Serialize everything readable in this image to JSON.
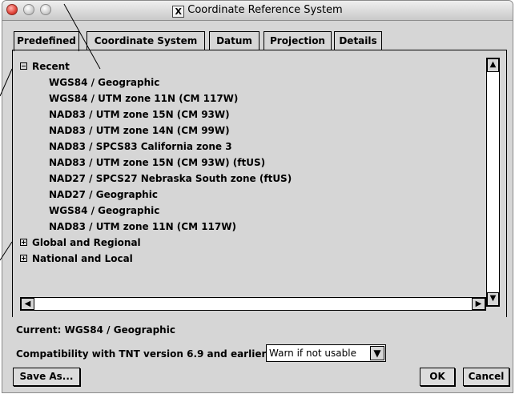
{
  "window": {
    "title": "Coordinate Reference System",
    "title_icon": "x11-icon"
  },
  "tabs": [
    {
      "label": "Predefined",
      "active": true
    },
    {
      "label": "Coordinate System",
      "active": false
    },
    {
      "label": "Datum",
      "active": false
    },
    {
      "label": "Projection",
      "active": false
    },
    {
      "label": "Details",
      "active": false
    }
  ],
  "tree": {
    "groups": [
      {
        "label": "Recent",
        "expanded": true,
        "items": [
          "WGS84 / Geographic",
          "WGS84 / UTM zone 11N (CM 117W)",
          "NAD83 / UTM zone 15N (CM 93W)",
          "NAD83 / UTM zone 14N (CM 99W)",
          "NAD83 / SPCS83 California zone 3",
          "NAD83 / UTM zone 15N (CM 93W) (ftUS)",
          "NAD27 / SPCS27 Nebraska South zone (ftUS)",
          "NAD27 / Geographic",
          "WGS84 / Geographic",
          "NAD83 / UTM zone 11N (CM 117W)"
        ]
      },
      {
        "label": "Global and Regional",
        "expanded": false,
        "items": []
      },
      {
        "label": "National and Local",
        "expanded": false,
        "items": []
      }
    ]
  },
  "status": {
    "current": "Current: WGS84 / Geographic"
  },
  "compat": {
    "label": "Compatibility with TNT version 6.9 and earlier:",
    "selected": "Warn if not usable"
  },
  "buttons": {
    "save_as": "Save As...",
    "ok": "OK",
    "cancel": "Cancel"
  },
  "colors": {
    "background": "#d6d6d6",
    "close_button": "#e0443a"
  }
}
